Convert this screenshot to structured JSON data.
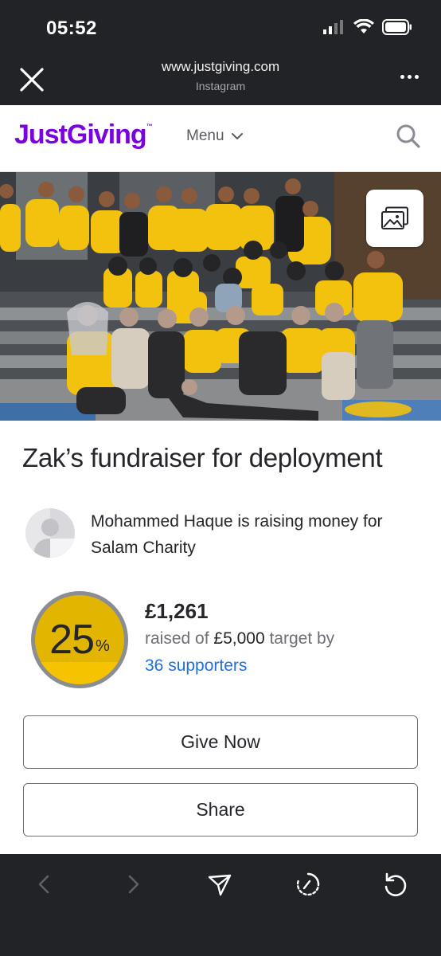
{
  "status_bar": {
    "time": "05:52"
  },
  "browser": {
    "url": "www.justgiving.com",
    "source_app": "Instagram",
    "close_icon": "close-icon",
    "more_icon": "more-dots-icon"
  },
  "site_header": {
    "logo": "JustGiving",
    "logo_tm": "™",
    "menu_label": "Menu",
    "search_icon": "search-icon"
  },
  "hero": {
    "gallery_icon": "image-gallery-icon"
  },
  "page": {
    "title": "Zak’s fundraiser for deployment",
    "organiser_text": "Mohammed Haque is raising money for Salam Charity"
  },
  "progress": {
    "percent": "25",
    "percent_sign": "%",
    "fraction": 0.25,
    "raised": "£1,261",
    "target_prefix": "raised of",
    "target_amount": "£5,000",
    "target_suffix": "target by",
    "supporters": "36 supporters"
  },
  "actions": {
    "give_now": "Give Now",
    "share": "Share"
  },
  "toolbar": {
    "back_icon": "back-icon",
    "forward_icon": "forward-icon",
    "send_icon": "send-icon",
    "history_icon": "history-icon",
    "reload_icon": "reload-icon"
  },
  "colors": {
    "brand_purple": "#7a04dd",
    "progress_yellow": "#f5c300",
    "progress_ring": "#8a8d91",
    "link_blue": "#1f6fd8",
    "chrome_dark": "#222326"
  }
}
